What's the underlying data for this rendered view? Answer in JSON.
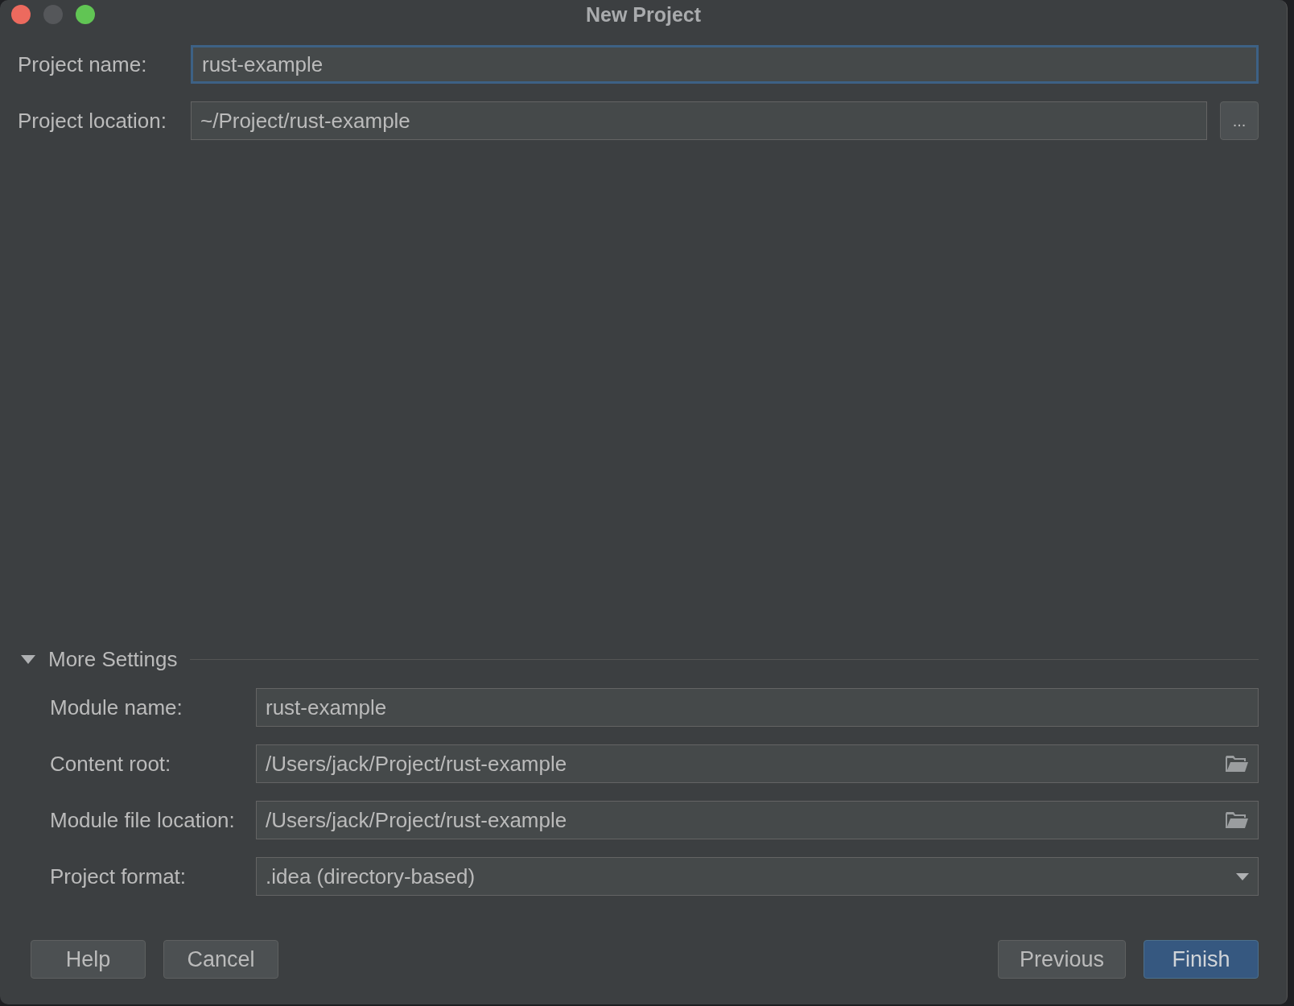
{
  "window": {
    "title": "New Project"
  },
  "project_fields": [
    {
      "label": "Project name:",
      "value": "rust-example",
      "focused": true,
      "kind": "text"
    },
    {
      "label": "Project location:",
      "value": "~/Project/rust-example",
      "focused": false,
      "kind": "browse-button",
      "button": "..."
    }
  ],
  "more_settings": {
    "title": "More Settings",
    "expanded": true,
    "fields": [
      {
        "label": "Module name:",
        "value": "rust-example",
        "kind": "text"
      },
      {
        "label": "Content root:",
        "value": "/Users/jack/Project/rust-example",
        "kind": "folder"
      },
      {
        "label": "Module file location:",
        "value": "/Users/jack/Project/rust-example",
        "kind": "folder"
      },
      {
        "label": "Project format:",
        "value": ".idea (directory-based)",
        "kind": "dropdown"
      }
    ]
  },
  "buttons_left": [
    "Help",
    "Cancel"
  ],
  "buttons_right": [
    {
      "label": "Previous",
      "default": false
    },
    {
      "label": "Finish",
      "default": true
    }
  ]
}
